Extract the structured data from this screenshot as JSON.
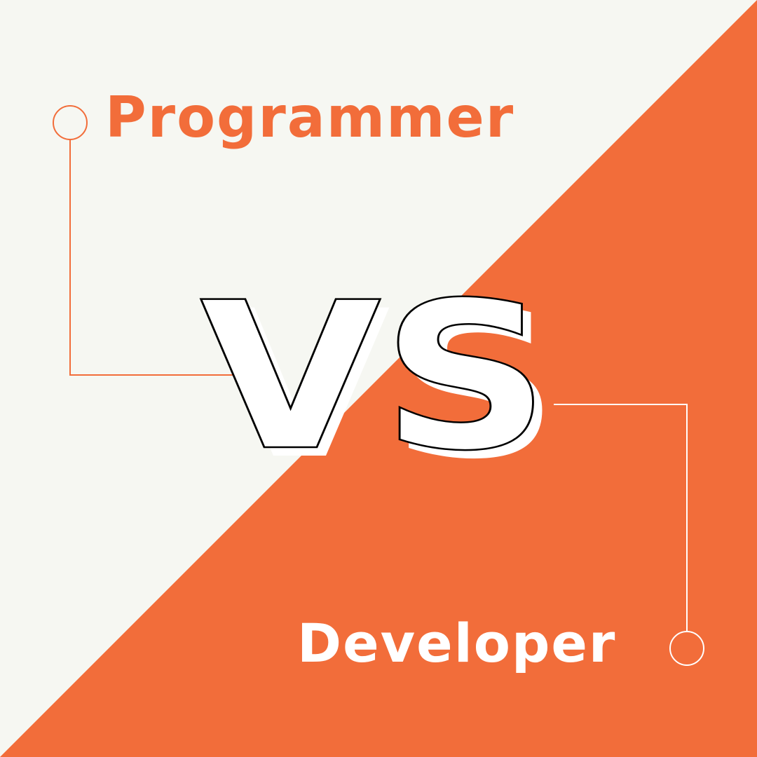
{
  "graphic": {
    "top_label": "Programmer",
    "center_label": "VS",
    "bottom_label": "Developer"
  },
  "colors": {
    "background": "#f6f7f2",
    "accent": "#f26d3a",
    "text_light": "#ffffff",
    "outline": "#000000"
  }
}
